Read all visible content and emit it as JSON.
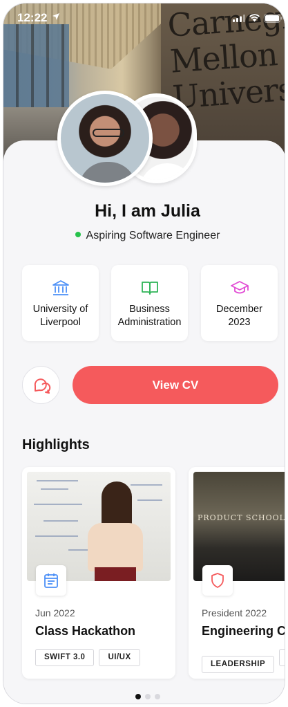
{
  "status_bar": {
    "time": "12:22"
  },
  "header": {
    "sign_lines": [
      "Carnegie",
      "Mellon",
      "University"
    ]
  },
  "profile": {
    "greeting": "Hi, I am Julia",
    "role": "Aspiring Software Engineer",
    "status_color": "#27c24c"
  },
  "info_cards": [
    {
      "icon": "bank-icon",
      "label": "University of Liverpool",
      "color": "#4a8ff7"
    },
    {
      "icon": "book-icon",
      "label": "Business Administration",
      "color": "#2fb457"
    },
    {
      "icon": "graduation-cap-icon",
      "label": "December 2023",
      "color": "#e14bd4"
    }
  ],
  "actions": {
    "chat_icon": "chat-bubbles-icon",
    "view_cv_label": "View CV",
    "accent_color": "#f55a5c"
  },
  "highlights": {
    "title": "Highlights",
    "items": [
      {
        "icon": "calendar-icon",
        "date": "Jun 2022",
        "title": "Class Hackathon",
        "tags": [
          "SWIFT 3.0",
          "UI/UX"
        ]
      },
      {
        "icon": "shield-icon",
        "image_text": "PRODUCT SCHOOL",
        "date": "President 2022",
        "title": "Engineering Cl",
        "tags": [
          "LEADERSHIP",
          ""
        ]
      }
    ],
    "pagination": {
      "pages": 3,
      "active": 1
    }
  }
}
